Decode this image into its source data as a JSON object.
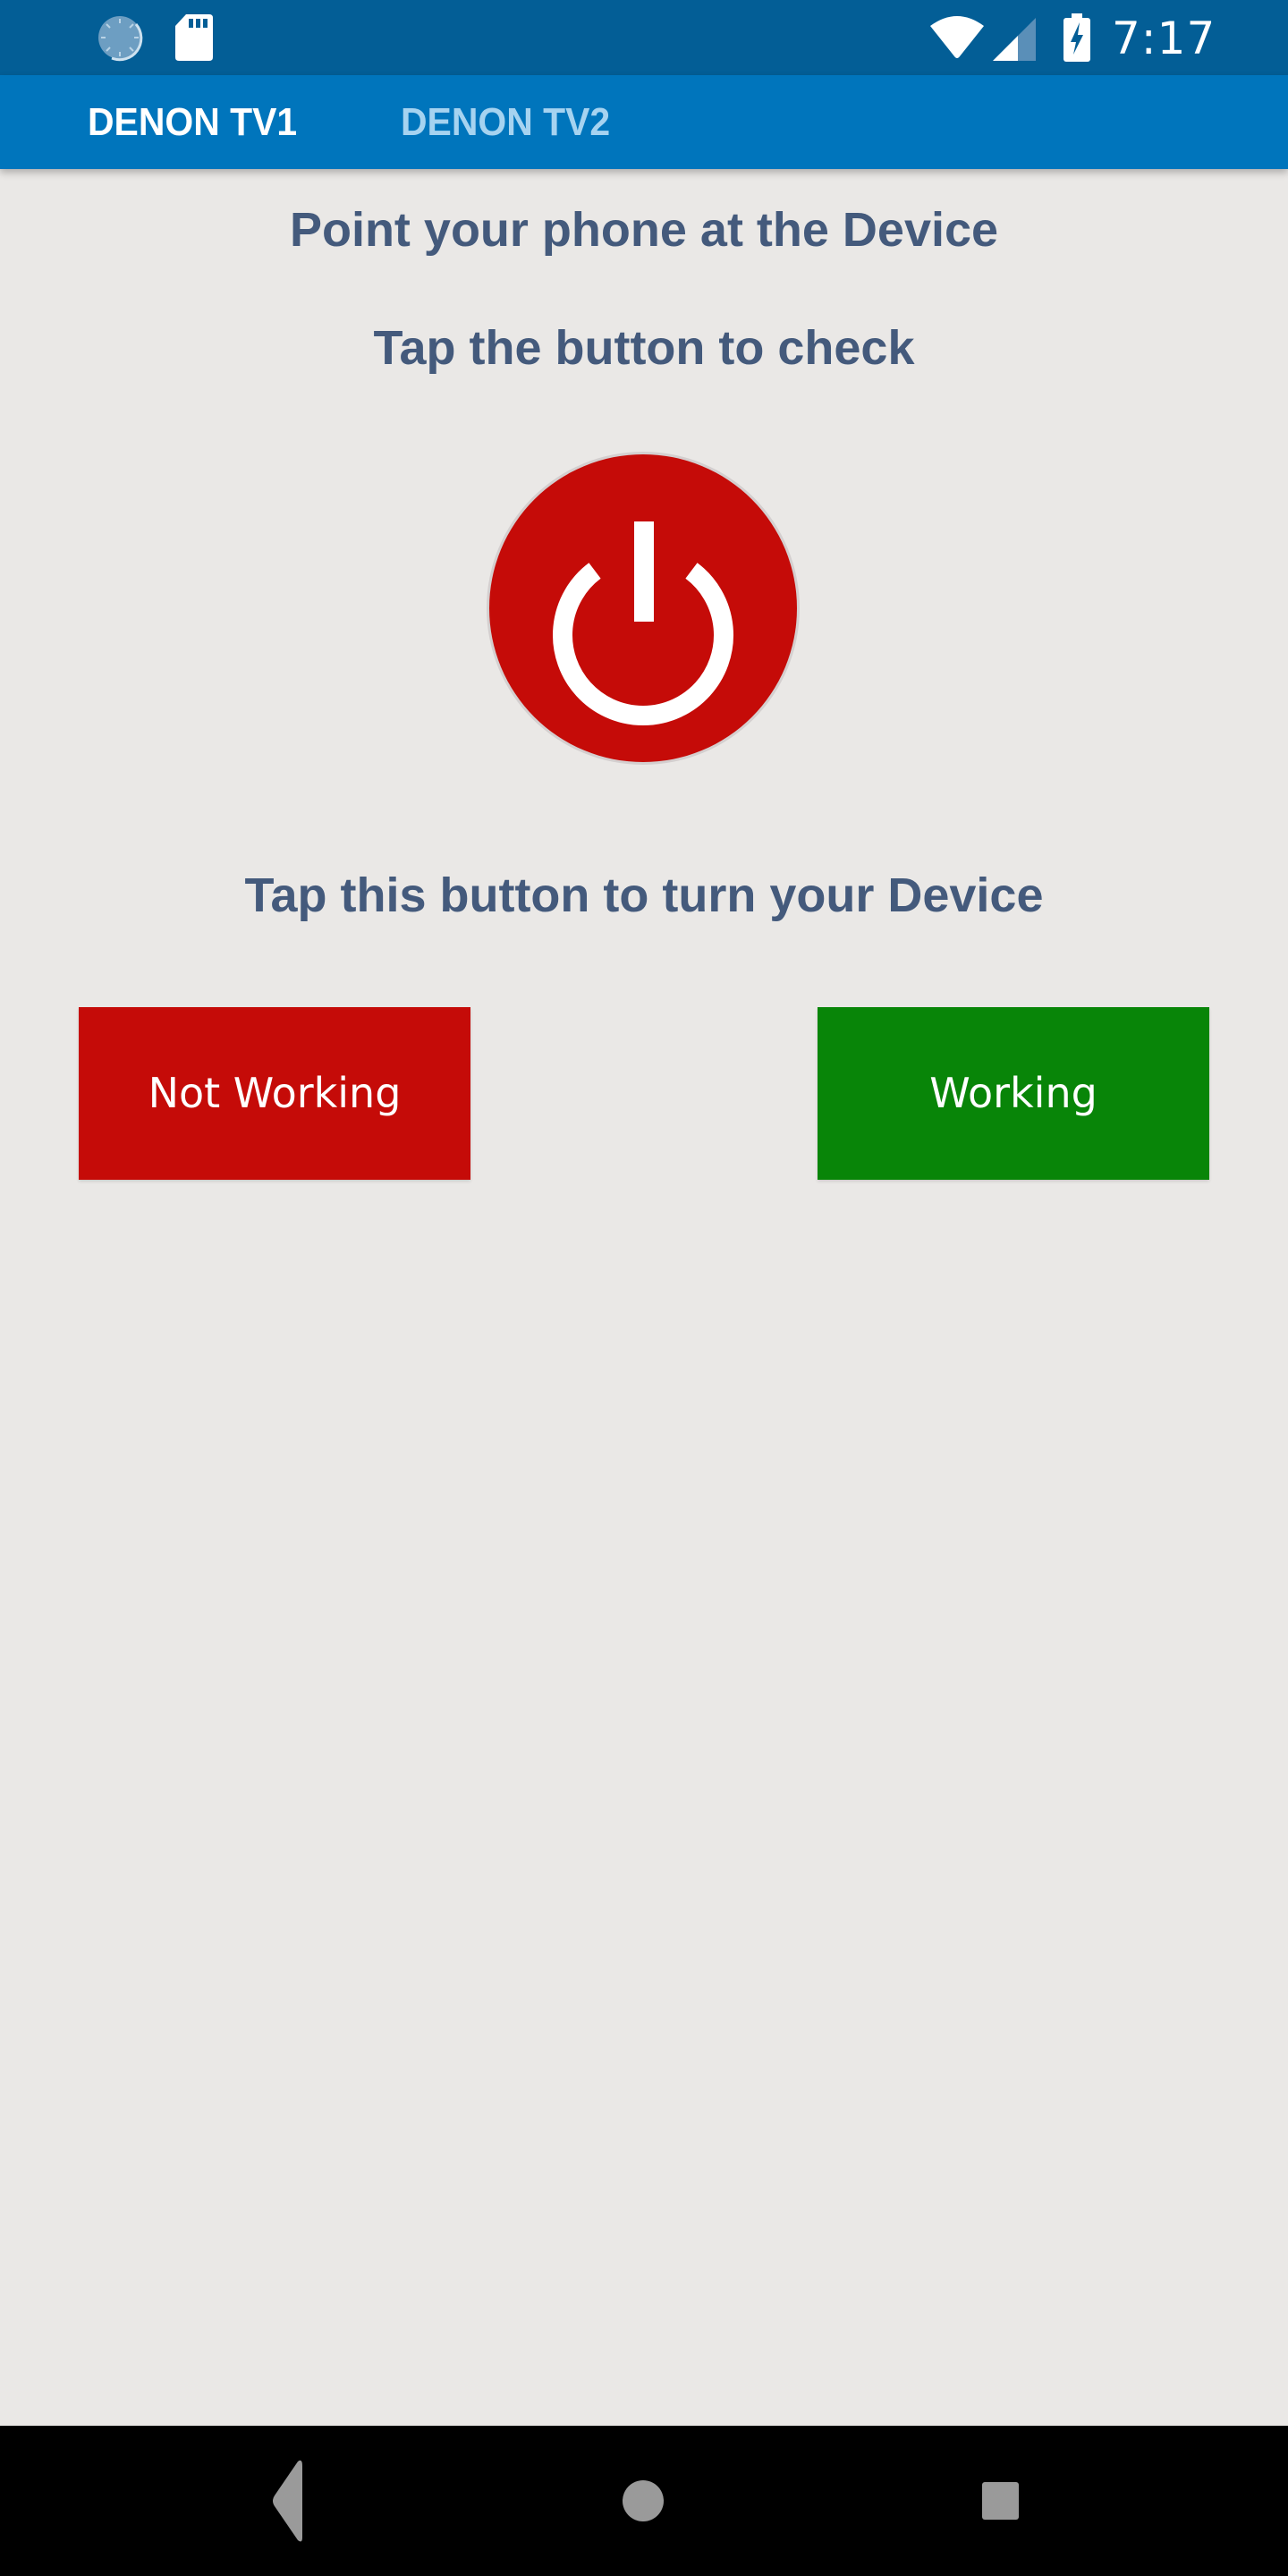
{
  "status_bar": {
    "time": "7:17",
    "left_icons": [
      "sync-icon",
      "sd-card-icon"
    ],
    "right_icons": [
      "wifi-icon",
      "cellular-signal-icon",
      "battery-charging-icon"
    ]
  },
  "tabs": [
    {
      "label": "DENON TV1",
      "active": true
    },
    {
      "label": "DENON TV2",
      "active": false
    }
  ],
  "main": {
    "instruction_1": "Point your phone at the Device",
    "instruction_2": "Tap the button to check",
    "power_button_icon": "power-icon",
    "instruction_3": "Tap this button to turn your Device",
    "not_working_label": "Not Working",
    "working_label": "Working"
  },
  "colors": {
    "status_bar": "#035e96",
    "tab_bar": "#0075bc",
    "text": "#445a7c",
    "red": "#c50b08",
    "green": "#088508",
    "background": "#eae8e6"
  },
  "nav_bar": {
    "icons": [
      "back-icon",
      "home-icon",
      "recents-icon"
    ]
  }
}
